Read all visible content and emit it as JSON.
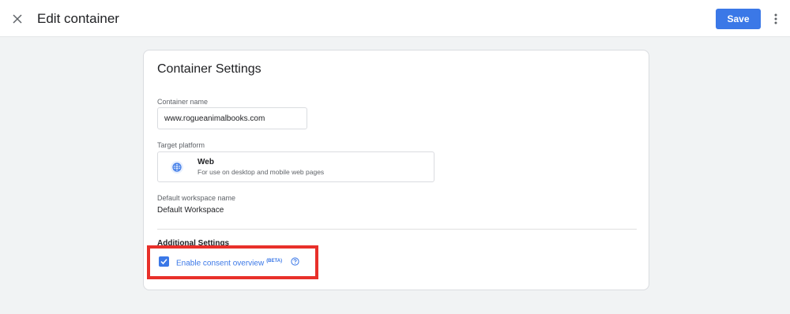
{
  "header": {
    "title": "Edit container",
    "save_label": "Save",
    "close_icon": "close-icon",
    "more_icon": "more-vert-icon"
  },
  "card": {
    "title": "Container Settings",
    "container_name": {
      "label": "Container name",
      "value": "www.rogueanimalbooks.com"
    },
    "target_platform": {
      "label": "Target platform",
      "name": "Web",
      "description": "For use on desktop and mobile web pages",
      "icon": "globe-icon"
    },
    "workspace": {
      "label": "Default workspace name",
      "value": "Default Workspace"
    },
    "additional": {
      "title": "Additional Settings",
      "consent_label": "Enable consent overview",
      "beta_label": "(BETA)",
      "checked": true,
      "help_icon": "help-icon"
    }
  },
  "colors": {
    "accent": "#3b78e7",
    "highlight": "#e8302a",
    "background": "#f1f3f4"
  }
}
